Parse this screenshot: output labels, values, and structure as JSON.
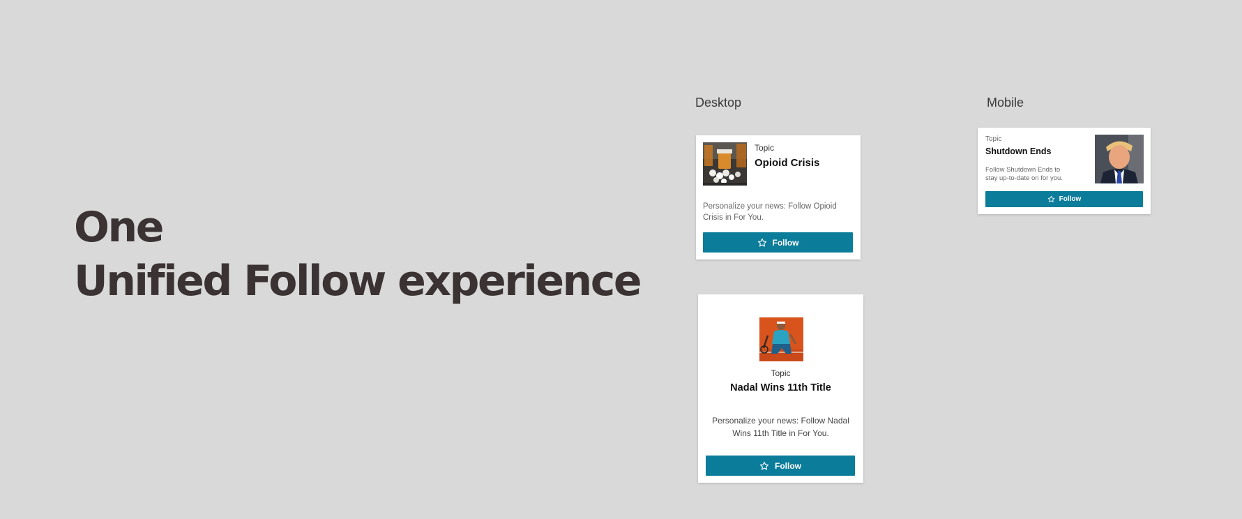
{
  "headline": {
    "line1": "One",
    "line2": "Unified Follow experience"
  },
  "sections": {
    "desktop_label": "Desktop",
    "mobile_label": "Mobile"
  },
  "desktop_card_1": {
    "topic_label": "Topic",
    "title": "Opioid Crisis",
    "description": "Personalize your news: Follow Opioid Crisis in For You.",
    "follow_label": "Follow",
    "image": "pill-bottles-photo"
  },
  "desktop_card_2": {
    "topic_label": "Topic",
    "title": "Nadal Wins 11th Title",
    "description": "Personalize your news: Follow Nadal Wins 11th Title in For You.",
    "follow_label": "Follow",
    "image": "tennis-player-photo"
  },
  "mobile_card": {
    "topic_label": "Topic",
    "title": "Shutdown Ends",
    "description": "Follow Shutdown Ends to stay up-to-date on for you.",
    "follow_label": "Follow",
    "image": "politician-portrait-photo"
  },
  "colors": {
    "background": "#d9d9d9",
    "accent": "#0b7c9a",
    "headline": "#3b3333"
  }
}
